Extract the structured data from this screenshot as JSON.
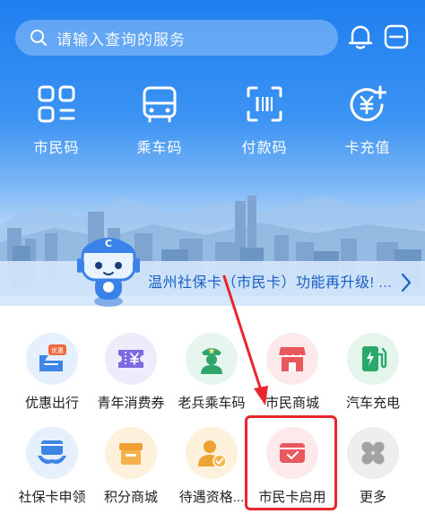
{
  "search": {
    "placeholder": "请输入查询的服务"
  },
  "header_icons": [
    "bell-icon",
    "scan-icon"
  ],
  "quick_actions": [
    {
      "label": "市民码",
      "icon": "qr-code-icon"
    },
    {
      "label": "乘车码",
      "icon": "bus-icon"
    },
    {
      "label": "付款码",
      "icon": "barcode-icon"
    },
    {
      "label": "卡充值",
      "icon": "yuan-recharge-icon"
    }
  ],
  "banner": {
    "text": "温州社保卡（市民卡）功能再升级! ..."
  },
  "services_row1": [
    {
      "label": "优惠出行",
      "icon": "discount-travel-icon",
      "badge": "优惠",
      "bg": "#e6f0fc",
      "color": "#3d86e6"
    },
    {
      "label": "青年消费券",
      "icon": "coupon-icon",
      "bg": "#eeebfb",
      "color": "#7b6ae0"
    },
    {
      "label": "老兵乘车码",
      "icon": "veteran-icon",
      "bg": "#e6f5ee",
      "color": "#2fa56a"
    },
    {
      "label": "市民商城",
      "icon": "shop-icon",
      "bg": "#fde9e9",
      "color": "#e8585c"
    },
    {
      "label": "汽车充电",
      "icon": "charging-icon",
      "bg": "#e4f5ec",
      "color": "#28a86b"
    }
  ],
  "services_row2": [
    {
      "label": "社保卡申领",
      "icon": "card-apply-icon",
      "bg": "#e6f0fc",
      "color": "#3d86e6"
    },
    {
      "label": "积分商城",
      "icon": "points-mall-icon",
      "bg": "#fdf1dc",
      "color": "#f0a030"
    },
    {
      "label": "待遇资格...",
      "icon": "qualification-icon",
      "bg": "#fdf1dc",
      "color": "#eea233"
    },
    {
      "label": "市民卡启用",
      "icon": "card-activate-icon",
      "bg": "#fde9e9",
      "color": "#e8585c"
    },
    {
      "label": "更多",
      "icon": "more-icon",
      "bg": "#eeeeee",
      "color": "#9a9a9a"
    }
  ],
  "annotation_color": "#e8262c"
}
